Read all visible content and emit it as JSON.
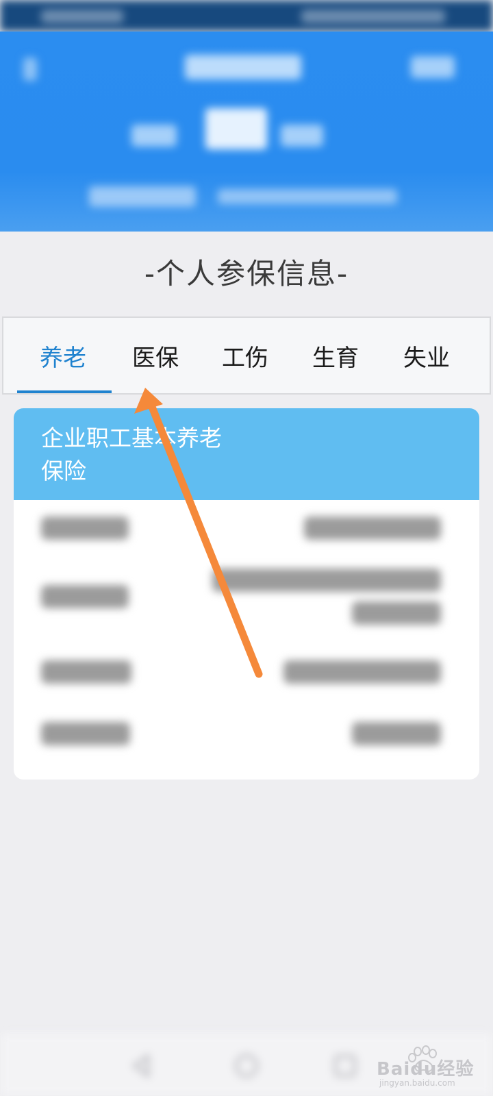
{
  "section_title": "-个人参保信息-",
  "tabs": [
    {
      "label": "养老",
      "active": true
    },
    {
      "label": "医保",
      "active": false
    },
    {
      "label": "工伤",
      "active": false
    },
    {
      "label": "生育",
      "active": false
    },
    {
      "label": "失业",
      "active": false
    }
  ],
  "card": {
    "title": "企业职工基本养老保险"
  },
  "watermark": {
    "brand": "Baidu经验",
    "url": "jingyan.baidu.com"
  },
  "colors": {
    "header_blue": "#2a8cef",
    "tab_active": "#1f82cf",
    "card_head": "#60bdf1",
    "arrow": "#f5893a"
  }
}
